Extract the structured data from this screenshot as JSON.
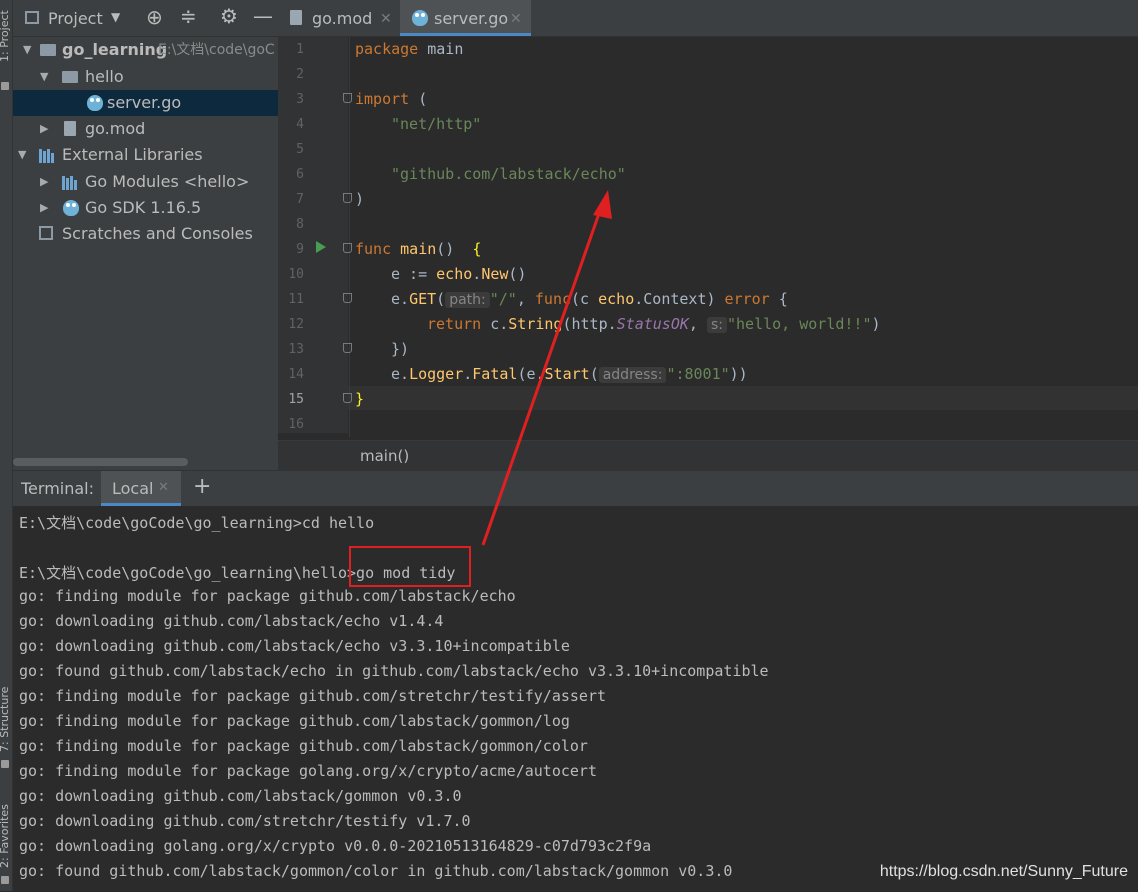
{
  "sidebar_tabs": {
    "project": "1: Project",
    "structure": "7: Structure",
    "favorites": "2: Favorites"
  },
  "project_panel": {
    "title": "Project",
    "tree": [
      {
        "label": "go_learning",
        "path": "E:\\文档\\code\\goC",
        "icon": "folder-icon"
      },
      {
        "label": "hello",
        "icon": "folder-icon"
      },
      {
        "label": "server.go",
        "icon": "gopher-icon"
      },
      {
        "label": "go.mod",
        "icon": "file-icon"
      },
      {
        "label": "External Libraries",
        "icon": "libraries-icon"
      },
      {
        "label": "Go Modules <hello>",
        "icon": "libraries-icon"
      },
      {
        "label": "Go SDK 1.16.5",
        "icon": "gopher-icon"
      },
      {
        "label": "Scratches and Consoles",
        "icon": "scratches-icon"
      }
    ]
  },
  "editor": {
    "tabs": [
      {
        "label": "go.mod",
        "icon": "file-icon"
      },
      {
        "label": "server.go",
        "icon": "gopher-icon"
      }
    ],
    "active_tab": "server.go",
    "line_numbers": [
      "1",
      "2",
      "3",
      "4",
      "5",
      "6",
      "7",
      "8",
      "9",
      "10",
      "11",
      "12",
      "13",
      "14",
      "15",
      "16"
    ],
    "current_line": 15,
    "code": {
      "l1_kw": "package",
      "l1_name": "main",
      "l3_kw": "import",
      "l3_paren": "(",
      "l4_str": "\"net/http\"",
      "l6_str": "\"github.com/labstack/echo\"",
      "l7": ")",
      "l9_kw": "func",
      "l9_fn": "main",
      "l9_rest": "()",
      "l9_brace": "{",
      "l10_a": "e := ",
      "l10_b": "echo",
      "l10_c": ".",
      "l10_d": "New",
      "l10_e": "()",
      "l11_a": "e.",
      "l11_b": "GET",
      "l11_c": "(",
      "l11_hint": "path:",
      "l11_str": "\"/\"",
      "l11_d": ", ",
      "l11_kw": "func",
      "l11_e": "(c ",
      "l11_f": "echo",
      "l11_g": ".Context) ",
      "l11_kw2": "error",
      "l11_h": " {",
      "l12_kw": "return",
      "l12_a": " c.",
      "l12_b": "String",
      "l12_c": "(http.",
      "l12_pk": "StatusOK",
      "l12_d": ", ",
      "l12_hint": "s:",
      "l12_str": "\"hello, world!!\"",
      "l12_e": ")",
      "l13": "})",
      "l14_a": "e.",
      "l14_b": "Logger",
      "l14_c": ".",
      "l14_d": "Fatal",
      "l14_e": "(e.",
      "l14_f": "Start",
      "l14_g": "(",
      "l14_hint": "address:",
      "l14_str": "\":8001\"",
      "l14_h": "))",
      "l15": "}"
    },
    "breadcrumb": "main()"
  },
  "terminal": {
    "title": "Terminal:",
    "tab": "Local",
    "add_label": "+",
    "lines": [
      "E:\\文档\\code\\goCode\\go_learning>cd hello",
      "",
      "E:\\文档\\code\\goCode\\go_learning\\hello>go mod tidy",
      "go: finding module for package github.com/labstack/echo",
      "go: downloading github.com/labstack/echo v1.4.4",
      "go: downloading github.com/labstack/echo v3.3.10+incompatible",
      "go: found github.com/labstack/echo in github.com/labstack/echo v3.3.10+incompatible",
      "go: finding module for package github.com/stretchr/testify/assert",
      "go: finding module for package github.com/labstack/gommon/log",
      "go: finding module for package github.com/labstack/gommon/color",
      "go: finding module for package golang.org/x/crypto/acme/autocert",
      "go: downloading github.com/labstack/gommon v0.3.0",
      "go: downloading github.com/stretchr/testify v1.7.0",
      "go: downloading golang.org/x/crypto v0.0.0-20210513164829-c07d793c2f9a",
      "go: found github.com/labstack/gommon/color in github.com/labstack/gommon v0.3.0"
    ]
  },
  "watermark": "https://blog.csdn.net/Sunny_Future",
  "colors": {
    "annotation": "#e02020",
    "accent": "#4a88c7"
  }
}
